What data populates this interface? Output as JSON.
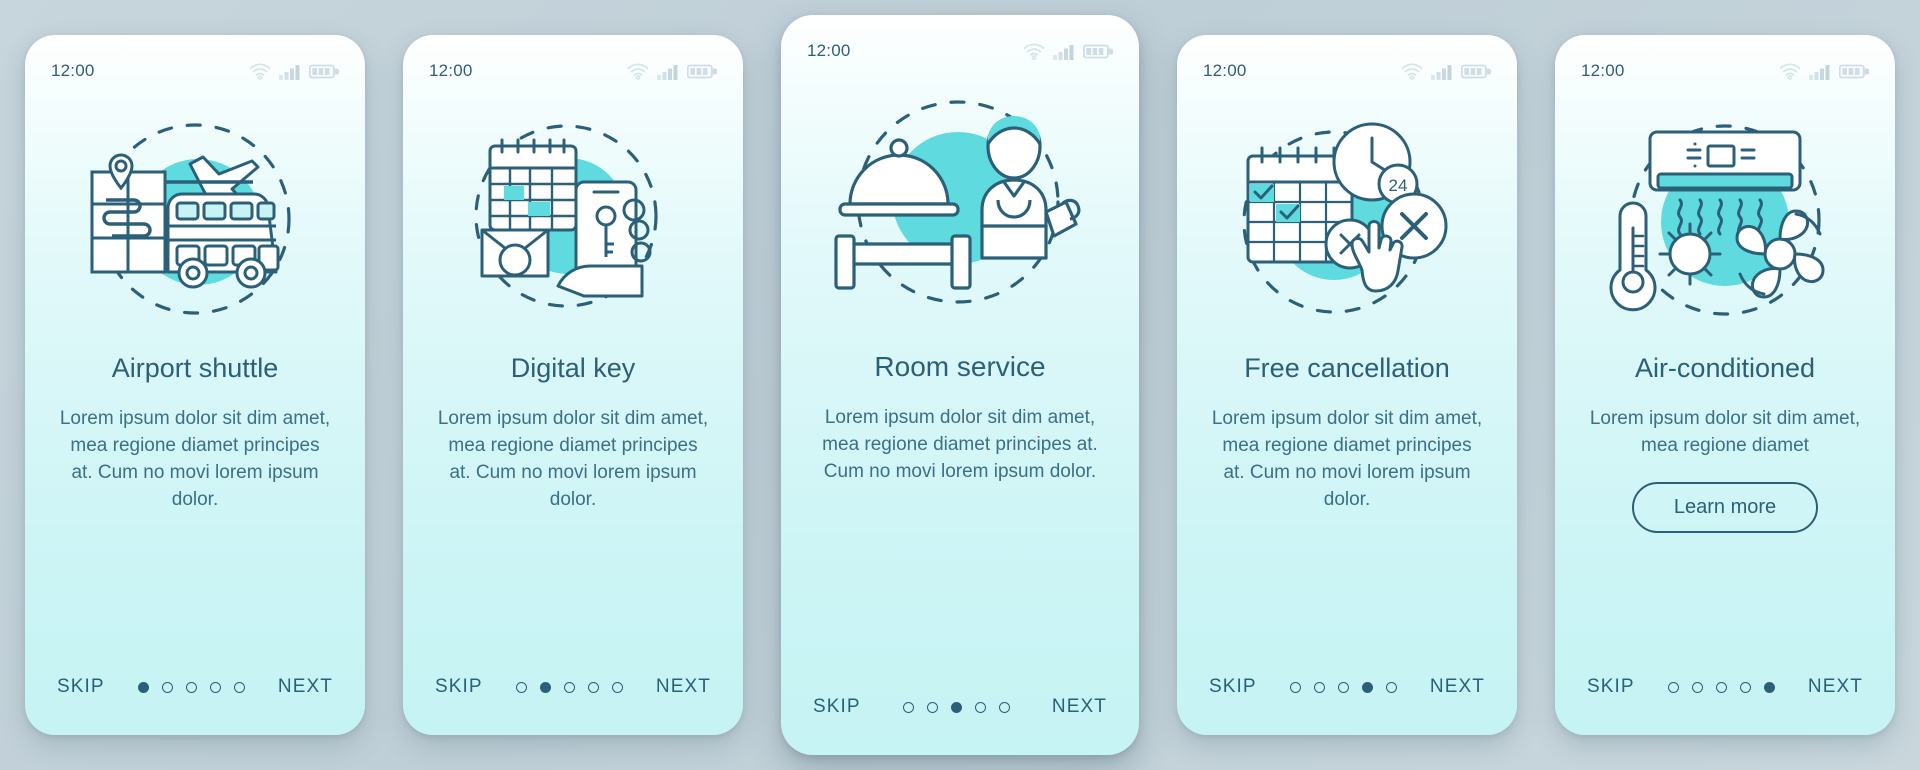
{
  "background_color": "#c5d3da",
  "theme": {
    "accent": "#5fdbe0",
    "ink": "#2b6078",
    "body_text": "#3b7086",
    "card_top": "#ffffff",
    "card_bottom": "#c6f3f4"
  },
  "status_bar": {
    "time": "12:00",
    "icons": [
      "wifi-icon",
      "cellular-signal-icon",
      "battery-icon"
    ]
  },
  "common": {
    "skip_label": "SKIP",
    "next_label": "NEXT",
    "total_steps": 5
  },
  "screens": [
    {
      "illustration": "airport-shuttle-illustration",
      "title": "Airport shuttle",
      "description": "Lorem ipsum dolor sit dim amet, mea regione diamet principes at. Cum no movi lorem ipsum dolor.",
      "active_step": 1,
      "skip_label": "SKIP",
      "next_label": "NEXT",
      "featured": false,
      "cta": null
    },
    {
      "illustration": "digital-key-illustration",
      "title": "Digital key",
      "description": "Lorem ipsum dolor sit dim amet, mea regione diamet principes at. Cum no movi lorem ipsum dolor.",
      "active_step": 2,
      "skip_label": "SKIP",
      "next_label": "NEXT",
      "featured": false,
      "cta": null
    },
    {
      "illustration": "room-service-illustration",
      "title": "Room service",
      "description": "Lorem ipsum dolor sit dim amet, mea regione diamet principes at. Cum no movi lorem ipsum dolor.",
      "active_step": 3,
      "skip_label": "SKIP",
      "next_label": "NEXT",
      "featured": true,
      "cta": null
    },
    {
      "illustration": "free-cancellation-illustration",
      "title": "Free cancellation",
      "description": "Lorem ipsum dolor sit dim amet, mea regione diamet principes at. Cum no movi lorem ipsum dolor.",
      "active_step": 4,
      "skip_label": "SKIP",
      "next_label": "NEXT",
      "featured": false,
      "cta": null
    },
    {
      "illustration": "air-conditioned-illustration",
      "title": "Air-conditioned",
      "description": "Lorem ipsum dolor sit dim amet, mea regione diamet",
      "active_step": 5,
      "skip_label": "SKIP",
      "next_label": "NEXT",
      "featured": false,
      "cta": "Learn more"
    }
  ]
}
